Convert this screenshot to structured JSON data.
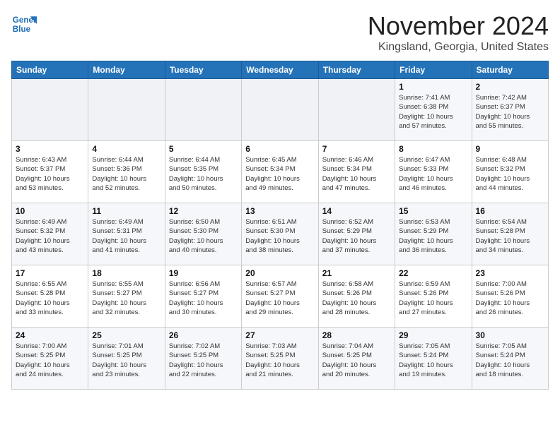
{
  "header": {
    "logo_line1": "General",
    "logo_line2": "Blue",
    "month": "November 2024",
    "location": "Kingsland, Georgia, United States"
  },
  "weekdays": [
    "Sunday",
    "Monday",
    "Tuesday",
    "Wednesday",
    "Thursday",
    "Friday",
    "Saturday"
  ],
  "weeks": [
    [
      {
        "day": "",
        "info": ""
      },
      {
        "day": "",
        "info": ""
      },
      {
        "day": "",
        "info": ""
      },
      {
        "day": "",
        "info": ""
      },
      {
        "day": "",
        "info": ""
      },
      {
        "day": "1",
        "info": "Sunrise: 7:41 AM\nSunset: 6:38 PM\nDaylight: 10 hours\nand 57 minutes."
      },
      {
        "day": "2",
        "info": "Sunrise: 7:42 AM\nSunset: 6:37 PM\nDaylight: 10 hours\nand 55 minutes."
      }
    ],
    [
      {
        "day": "3",
        "info": "Sunrise: 6:43 AM\nSunset: 5:37 PM\nDaylight: 10 hours\nand 53 minutes."
      },
      {
        "day": "4",
        "info": "Sunrise: 6:44 AM\nSunset: 5:36 PM\nDaylight: 10 hours\nand 52 minutes."
      },
      {
        "day": "5",
        "info": "Sunrise: 6:44 AM\nSunset: 5:35 PM\nDaylight: 10 hours\nand 50 minutes."
      },
      {
        "day": "6",
        "info": "Sunrise: 6:45 AM\nSunset: 5:34 PM\nDaylight: 10 hours\nand 49 minutes."
      },
      {
        "day": "7",
        "info": "Sunrise: 6:46 AM\nSunset: 5:34 PM\nDaylight: 10 hours\nand 47 minutes."
      },
      {
        "day": "8",
        "info": "Sunrise: 6:47 AM\nSunset: 5:33 PM\nDaylight: 10 hours\nand 46 minutes."
      },
      {
        "day": "9",
        "info": "Sunrise: 6:48 AM\nSunset: 5:32 PM\nDaylight: 10 hours\nand 44 minutes."
      }
    ],
    [
      {
        "day": "10",
        "info": "Sunrise: 6:49 AM\nSunset: 5:32 PM\nDaylight: 10 hours\nand 43 minutes."
      },
      {
        "day": "11",
        "info": "Sunrise: 6:49 AM\nSunset: 5:31 PM\nDaylight: 10 hours\nand 41 minutes."
      },
      {
        "day": "12",
        "info": "Sunrise: 6:50 AM\nSunset: 5:30 PM\nDaylight: 10 hours\nand 40 minutes."
      },
      {
        "day": "13",
        "info": "Sunrise: 6:51 AM\nSunset: 5:30 PM\nDaylight: 10 hours\nand 38 minutes."
      },
      {
        "day": "14",
        "info": "Sunrise: 6:52 AM\nSunset: 5:29 PM\nDaylight: 10 hours\nand 37 minutes."
      },
      {
        "day": "15",
        "info": "Sunrise: 6:53 AM\nSunset: 5:29 PM\nDaylight: 10 hours\nand 36 minutes."
      },
      {
        "day": "16",
        "info": "Sunrise: 6:54 AM\nSunset: 5:28 PM\nDaylight: 10 hours\nand 34 minutes."
      }
    ],
    [
      {
        "day": "17",
        "info": "Sunrise: 6:55 AM\nSunset: 5:28 PM\nDaylight: 10 hours\nand 33 minutes."
      },
      {
        "day": "18",
        "info": "Sunrise: 6:55 AM\nSunset: 5:27 PM\nDaylight: 10 hours\nand 32 minutes."
      },
      {
        "day": "19",
        "info": "Sunrise: 6:56 AM\nSunset: 5:27 PM\nDaylight: 10 hours\nand 30 minutes."
      },
      {
        "day": "20",
        "info": "Sunrise: 6:57 AM\nSunset: 5:27 PM\nDaylight: 10 hours\nand 29 minutes."
      },
      {
        "day": "21",
        "info": "Sunrise: 6:58 AM\nSunset: 5:26 PM\nDaylight: 10 hours\nand 28 minutes."
      },
      {
        "day": "22",
        "info": "Sunrise: 6:59 AM\nSunset: 5:26 PM\nDaylight: 10 hours\nand 27 minutes."
      },
      {
        "day": "23",
        "info": "Sunrise: 7:00 AM\nSunset: 5:26 PM\nDaylight: 10 hours\nand 26 minutes."
      }
    ],
    [
      {
        "day": "24",
        "info": "Sunrise: 7:00 AM\nSunset: 5:25 PM\nDaylight: 10 hours\nand 24 minutes."
      },
      {
        "day": "25",
        "info": "Sunrise: 7:01 AM\nSunset: 5:25 PM\nDaylight: 10 hours\nand 23 minutes."
      },
      {
        "day": "26",
        "info": "Sunrise: 7:02 AM\nSunset: 5:25 PM\nDaylight: 10 hours\nand 22 minutes."
      },
      {
        "day": "27",
        "info": "Sunrise: 7:03 AM\nSunset: 5:25 PM\nDaylight: 10 hours\nand 21 minutes."
      },
      {
        "day": "28",
        "info": "Sunrise: 7:04 AM\nSunset: 5:25 PM\nDaylight: 10 hours\nand 20 minutes."
      },
      {
        "day": "29",
        "info": "Sunrise: 7:05 AM\nSunset: 5:24 PM\nDaylight: 10 hours\nand 19 minutes."
      },
      {
        "day": "30",
        "info": "Sunrise: 7:05 AM\nSunset: 5:24 PM\nDaylight: 10 hours\nand 18 minutes."
      }
    ]
  ]
}
